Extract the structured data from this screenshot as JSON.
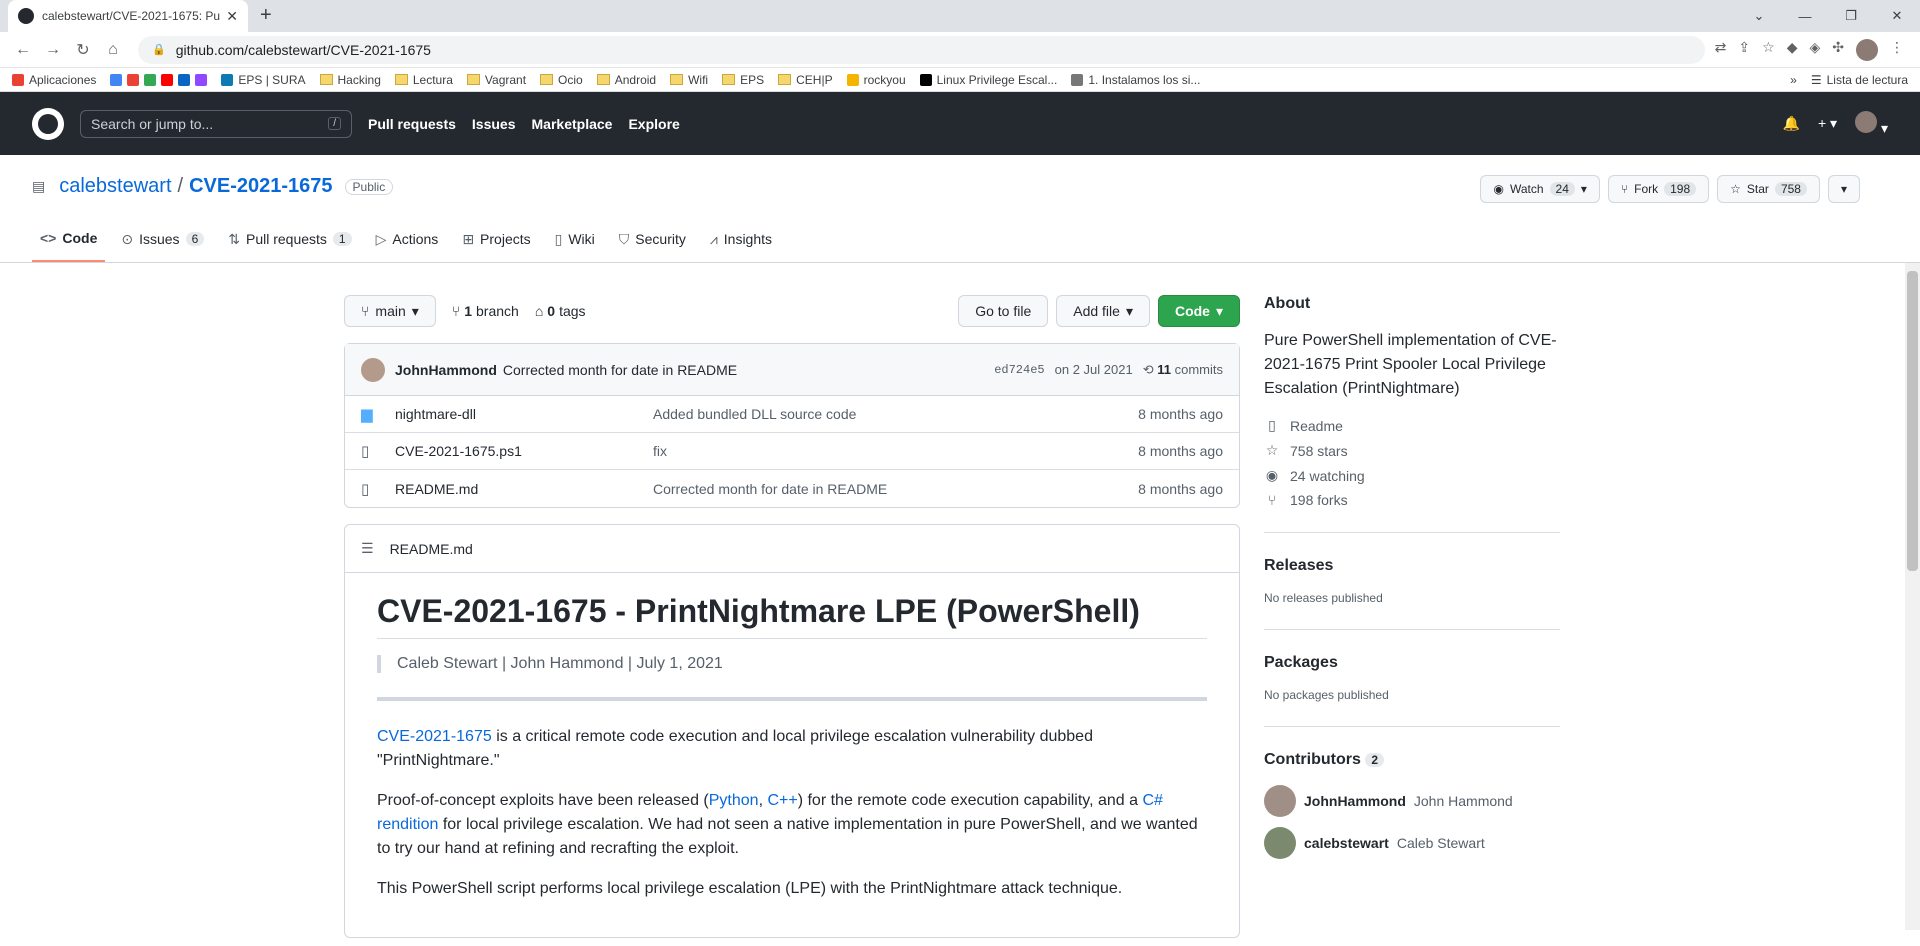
{
  "browser": {
    "tab_title": "calebstewart/CVE-2021-1675: Pu",
    "new_tab": "+",
    "url": "github.com/calebstewart/CVE-2021-1675",
    "bookmarks": [
      "Aplicaciones",
      "EPS | SURA",
      "Hacking",
      "Lectura",
      "Vagrant",
      "Ocio",
      "Android",
      "Wifi",
      "EPS",
      "CEH|P",
      "rockyou",
      "Linux Privilege Escal...",
      "1. Instalamos los si..."
    ],
    "reading_list": "Lista de lectura"
  },
  "gh": {
    "search_placeholder": "Search or jump to...",
    "slash": "/",
    "nav": [
      "Pull requests",
      "Issues",
      "Marketplace",
      "Explore"
    ]
  },
  "repo": {
    "owner": "calebstewart",
    "sep": "/",
    "name": "CVE-2021-1675",
    "visibility": "Public",
    "watch_label": "Watch",
    "watch_count": "24",
    "fork_label": "Fork",
    "fork_count": "198",
    "star_label": "Star",
    "star_count": "758",
    "tabs": [
      {
        "label": "Code",
        "count": ""
      },
      {
        "label": "Issues",
        "count": "6"
      },
      {
        "label": "Pull requests",
        "count": "1"
      },
      {
        "label": "Actions",
        "count": ""
      },
      {
        "label": "Projects",
        "count": ""
      },
      {
        "label": "Wiki",
        "count": ""
      },
      {
        "label": "Security",
        "count": ""
      },
      {
        "label": "Insights",
        "count": ""
      }
    ]
  },
  "toolbar": {
    "branch": "main",
    "branches_count": "1",
    "branches_label": "branch",
    "tags_count": "0",
    "tags_label": "tags",
    "go_to_file": "Go to file",
    "add_file": "Add file",
    "code": "Code"
  },
  "commit": {
    "author": "JohnHammond",
    "message": "Corrected month for date in README",
    "sha": "ed724e5",
    "date": "on 2 Jul 2021",
    "commits_count": "11",
    "commits_label": "commits"
  },
  "files": [
    {
      "name": "nightmare-dll",
      "type": "dir",
      "message": "Added bundled DLL source code",
      "age": "8 months ago"
    },
    {
      "name": "CVE-2021-1675.ps1",
      "type": "file",
      "message": "fix",
      "age": "8 months ago"
    },
    {
      "name": "README.md",
      "type": "file",
      "message": "Corrected month for date in README",
      "age": "8 months ago"
    }
  ],
  "readme": {
    "header": "README.md",
    "title": "CVE-2021-1675 - PrintNightmare LPE (PowerShell)",
    "quote": "Caleb Stewart | John Hammond | July 1, 2021",
    "p1_link": "CVE-2021-1675",
    "p1_text": " is a critical remote code execution and local privilege escalation vulnerability dubbed \"PrintNightmare.\"",
    "p2_a": "Proof-of-concept exploits have been released (",
    "p2_link1": "Python",
    "p2_comma": ", ",
    "p2_link2": "C++",
    "p2_b": ") for the remote code execution capability, and a ",
    "p2_link3": "C# rendition",
    "p2_c": " for local privilege escalation. We had not seen a native implementation in pure PowerShell, and we wanted to try our hand at refining and recrafting the exploit.",
    "p3": "This PowerShell script performs local privilege escalation (LPE) with the PrintNightmare attack technique."
  },
  "about": {
    "heading": "About",
    "description": "Pure PowerShell implementation of CVE-2021-1675 Print Spooler Local Privilege Escalation (PrintNightmare)",
    "readme": "Readme",
    "stars": "758 stars",
    "watching": "24 watching",
    "forks": "198 forks"
  },
  "releases": {
    "heading": "Releases",
    "text": "No releases published"
  },
  "packages": {
    "heading": "Packages",
    "text": "No packages published"
  },
  "contributors": {
    "heading": "Contributors",
    "count": "2",
    "list": [
      {
        "login": "JohnHammond",
        "name": "John Hammond"
      },
      {
        "login": "calebstewart",
        "name": "Caleb Stewart"
      }
    ]
  }
}
